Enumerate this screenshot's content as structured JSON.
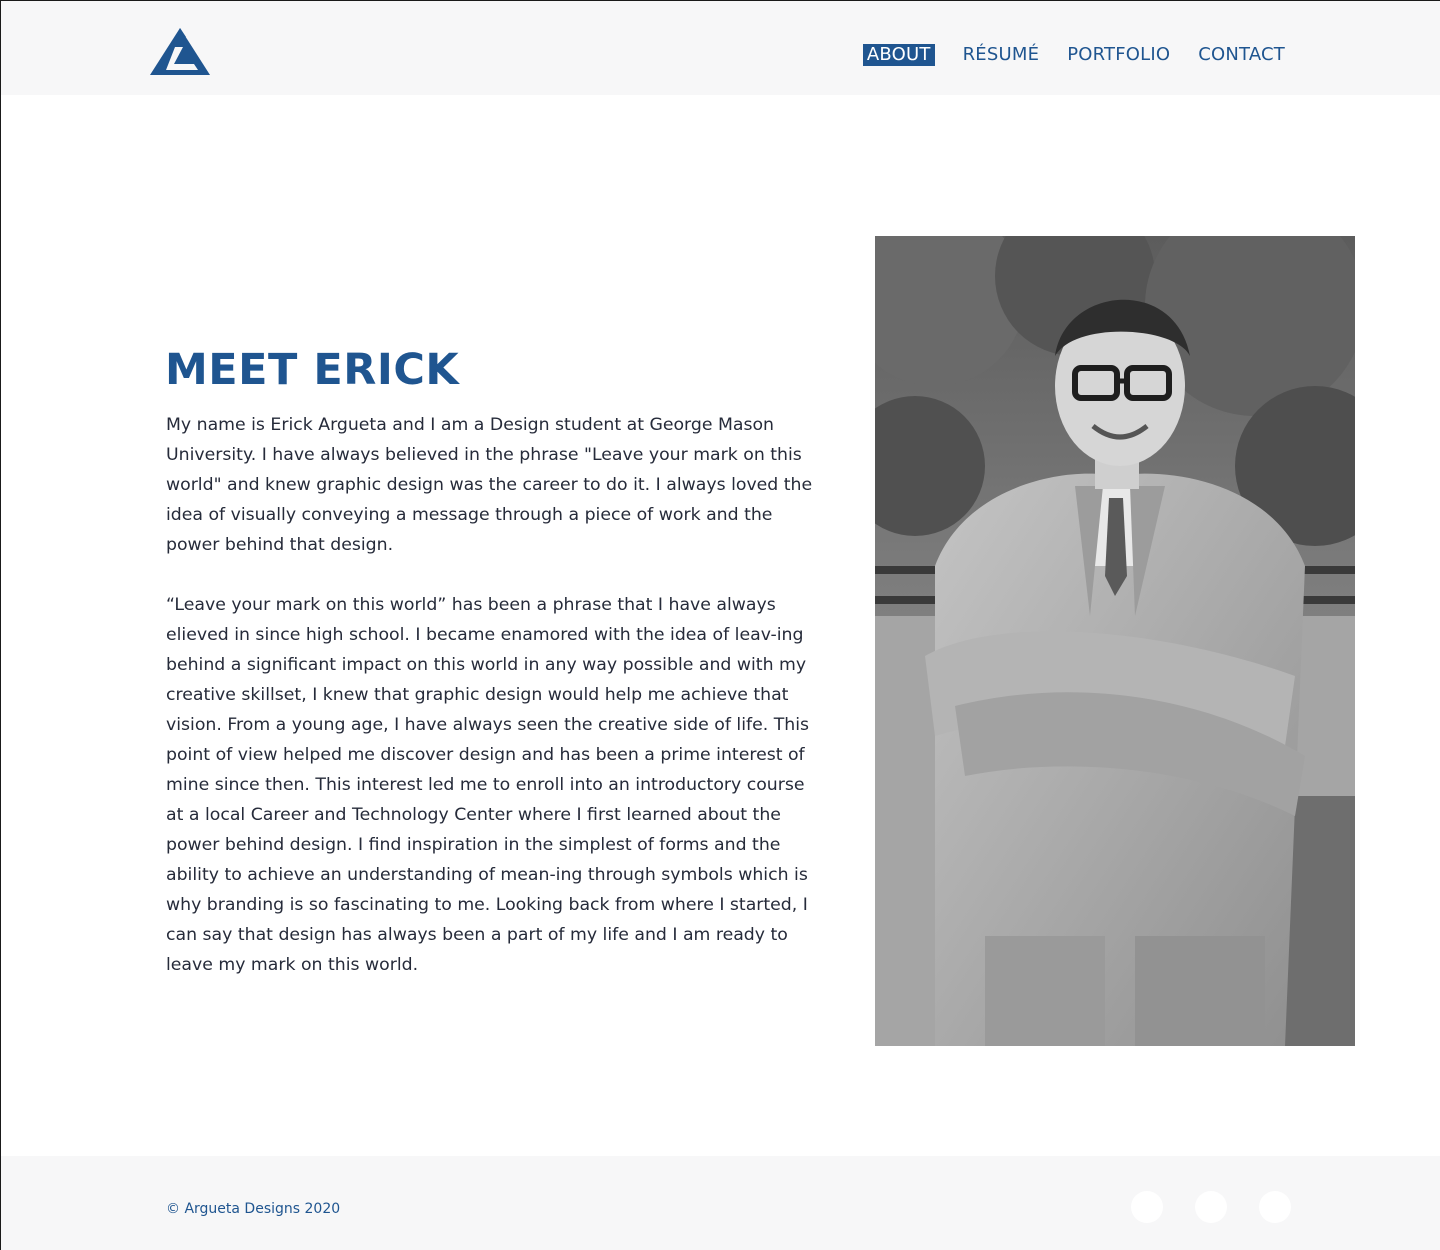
{
  "header": {
    "logo_icon": "argueta-designs-logo-icon",
    "nav": [
      {
        "label": "ABOUT",
        "active": true
      },
      {
        "label": "RÉSUMÉ",
        "active": false
      },
      {
        "label": "PORTFOLIO",
        "active": false
      },
      {
        "label": "CONTACT",
        "active": false
      }
    ]
  },
  "main": {
    "title": "MEET ERICK",
    "paragraphs": [
      "My name is Erick Argueta and I am a Design student at George Mason University. I have always believed in the phrase \"Leave your mark on this world\" and knew graphic design was the career to do it. I always loved the idea of visually conveying a message through a piece of work and the power behind that design.",
      "“Leave your mark on this world” has been a phrase that I have always elieved in since high school. I became enamored with the idea of leav-ing behind a significant impact on this world in any way possible and with my creative skillset, I knew that graphic design would help me achieve that vision. From a young age, I have always seen the creative side of life. This point of view helped me discover design and has been a prime interest of mine since then. This interest led me to enroll into an introductory course at a local Career and Technology Center where I first learned about the power behind design. I find inspiration in the simplest of forms and the ability to achieve an understanding of mean-ing through symbols which is why branding is so fascinating to me. Looking back from where I started, I can say that design has always been a part of my life and I am ready to leave my mark on this world."
    ],
    "photo_icon": "portrait-photo"
  },
  "footer": {
    "copyright": "© Argueta Designs 2020",
    "social_icons": [
      "social-icon-1",
      "social-icon-2",
      "social-icon-3"
    ]
  },
  "colors": {
    "brand_blue": "#1f5590",
    "header_bg": "#f7f7f8",
    "body_text": "#262b3a"
  }
}
